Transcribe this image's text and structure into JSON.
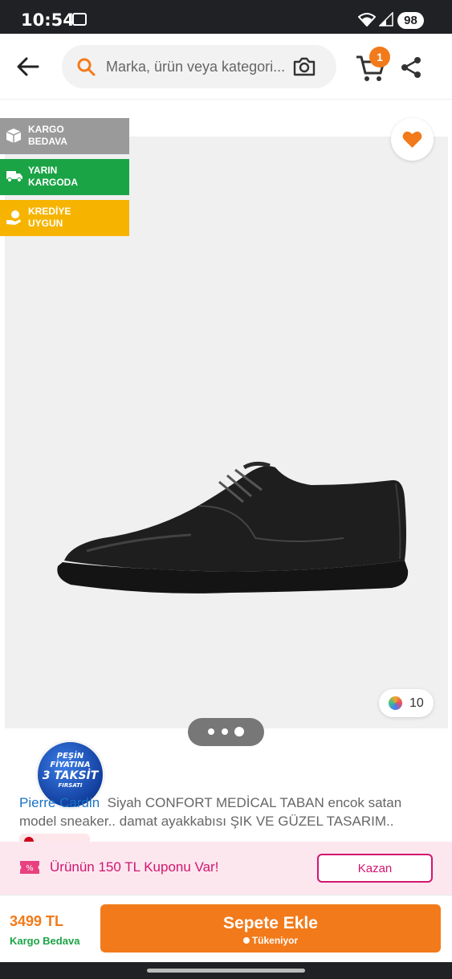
{
  "status_bar": {
    "time": "10:54",
    "battery": "98"
  },
  "search": {
    "placeholder": "Marka, ürün veya kategori..."
  },
  "cart": {
    "count": "1"
  },
  "tags": [
    {
      "line1": "KARGO",
      "line2": "BEDAVA",
      "color": "#9a9a9a"
    },
    {
      "line1": "YARIN",
      "line2": "KARGODA",
      "color": "#1ba446"
    },
    {
      "line1": "KREDİYE",
      "line2": "UYGUN",
      "color": "#f6b400"
    }
  ],
  "promo_badge": {
    "line1": "PEŞİN",
    "line2": "FİYATINA",
    "line3": "3 TAKSİT",
    "line4": "FIRSATI"
  },
  "gallery": {
    "color_count": "10",
    "pages": 3,
    "active_page": 3
  },
  "product": {
    "brand": "Pierre Cardin",
    "title": "Siyah CONFORT MEDİCAL TABAN  encok satan model sneaker.. damat ayakkabısı ŞIK VE GÜZEL TASARIM.."
  },
  "coupon": {
    "text": "Ürünün 150 TL Kuponu Var!",
    "button": "Kazan"
  },
  "bottom_bar": {
    "price": "3499 TL",
    "shipping": "Kargo Bedava",
    "add_to_cart": "Sepete Ekle",
    "stock_note": "Tükeniyor"
  },
  "colors": {
    "accent": "#f27a1a",
    "green": "#1ba446",
    "coupon_pink": "#d11670",
    "brand_link": "#1a73c7"
  }
}
